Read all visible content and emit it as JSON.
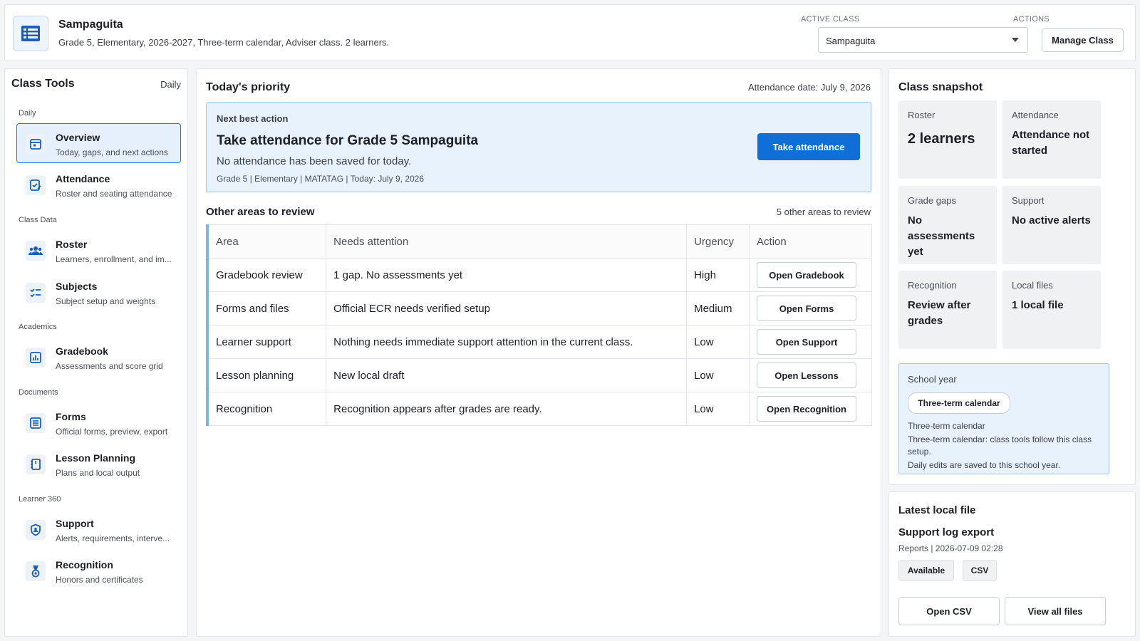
{
  "header": {
    "icon": "table-icon",
    "title": "Sampaguita",
    "subtitle": "Grade 5, Elementary, 2026-2027, Three-term calendar, Adviser class. 2 learners.",
    "active_class_label": "ACTIVE CLASS",
    "active_class_value": "Sampaguita",
    "actions_label": "ACTIONS",
    "manage_button": "Manage Class"
  },
  "sidebar": {
    "title": "Class Tools",
    "mode": "Daily",
    "groups": [
      {
        "label": "Daily",
        "items": [
          {
            "label": "Overview",
            "desc": "Today, gaps, and next actions",
            "icon": "calendar-icon",
            "active": true
          },
          {
            "label": "Attendance",
            "desc": "Roster and seating attendance",
            "icon": "checklist-edit-icon"
          }
        ]
      },
      {
        "label": "Class Data",
        "items": [
          {
            "label": "Roster",
            "desc": "Learners, enrollment, and im...",
            "icon": "people-icon"
          },
          {
            "label": "Subjects",
            "desc": "Subject setup and weights",
            "icon": "list-check-icon"
          }
        ]
      },
      {
        "label": "Academics",
        "items": [
          {
            "label": "Gradebook",
            "desc": "Assessments and score grid",
            "icon": "chart-add-icon"
          }
        ]
      },
      {
        "label": "Documents",
        "items": [
          {
            "label": "Forms",
            "desc": "Official forms, preview, export",
            "icon": "form-icon"
          },
          {
            "label": "Lesson Planning",
            "desc": "Plans and local output",
            "icon": "notebook-icon"
          }
        ]
      },
      {
        "label": "Learner 360",
        "items": [
          {
            "label": "Support",
            "desc": "Alerts, requirements, interve...",
            "icon": "shield-person-icon"
          },
          {
            "label": "Recognition",
            "desc": "Honors and certificates",
            "icon": "medal-icon"
          }
        ]
      }
    ]
  },
  "main": {
    "title": "Today's priority",
    "attendance_date": "Attendance date: July 9, 2026",
    "priority": {
      "kicker": "Next best action",
      "headline": "Take attendance for Grade 5 Sampaguita",
      "text": "No attendance has been saved for today.",
      "meta": "Grade 5 | Elementary | MATATAG | Today: July 9, 2026",
      "button": "Take attendance"
    },
    "review": {
      "title": "Other areas to review",
      "count": "5 other areas to review",
      "columns": [
        "Area",
        "Needs attention",
        "Urgency",
        "Action"
      ],
      "rows": [
        {
          "area": "Gradebook review",
          "needs": "1 gap. No assessments yet",
          "urgency": "High",
          "action": "Open Gradebook"
        },
        {
          "area": "Forms and files",
          "needs": "Official ECR needs verified setup",
          "urgency": "Medium",
          "action": "Open Forms"
        },
        {
          "area": "Learner support",
          "needs": "Nothing needs immediate support attention in the current class.",
          "urgency": "Low",
          "action": "Open Support"
        },
        {
          "area": "Lesson planning",
          "needs": "New local draft",
          "urgency": "Low",
          "action": "Open Lessons"
        },
        {
          "area": "Recognition",
          "needs": "Recognition appears after grades are ready.",
          "urgency": "Low",
          "action": "Open Recognition"
        }
      ]
    }
  },
  "snapshot": {
    "title": "Class snapshot",
    "cards": [
      {
        "label": "Roster",
        "value": "2 learners"
      },
      {
        "label": "Attendance",
        "value": "Attendance not started"
      },
      {
        "label": "Grade gaps",
        "value": "No assessments yet"
      },
      {
        "label": "Support",
        "value": "No active alerts"
      },
      {
        "label": "Recognition",
        "value": "Review after grades"
      },
      {
        "label": "Local files",
        "value": "1 local file"
      }
    ],
    "school_year": {
      "label": "School year",
      "chip": "Three-term calendar",
      "line1": "Three-term calendar",
      "line2": "Three-term calendar: class tools follow this class setup.",
      "line3": "Daily edits are saved to this school year."
    }
  },
  "latest_file": {
    "title": "Latest local file",
    "name": "Support log export",
    "meta": "Reports | 2026-07-09 02:28",
    "status_chip": "Available",
    "type_chip": "CSV",
    "open_button": "Open CSV",
    "view_all_button": "View all files"
  },
  "colors": {
    "accent": "#0f6fd6",
    "active_bg": "#e6f0fc",
    "priority_bg": "#e8f2fc"
  }
}
